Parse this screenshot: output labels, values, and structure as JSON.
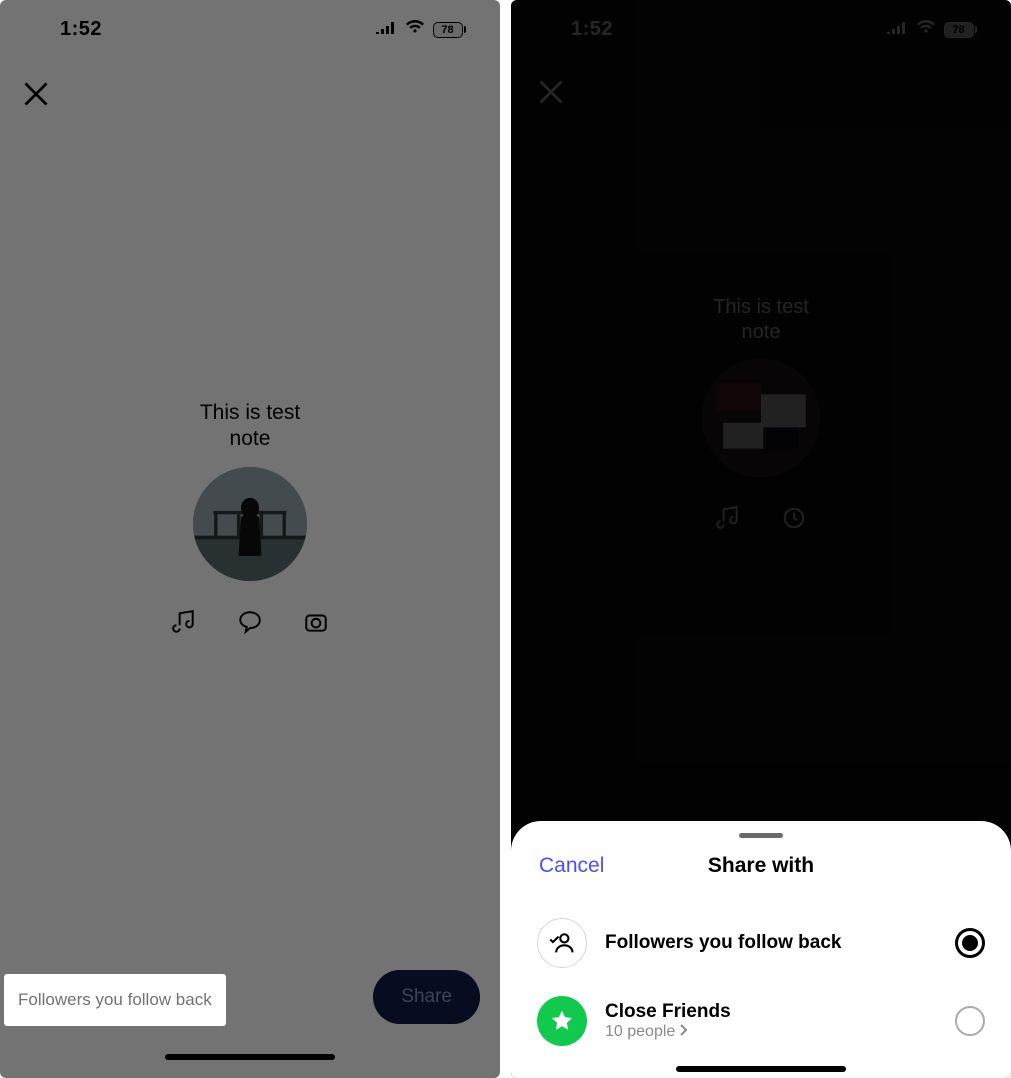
{
  "status": {
    "time": "1:52",
    "battery_pct": "78"
  },
  "left": {
    "note_text": "This is test\nnote",
    "chip_label": "Followers you follow back",
    "share_label": "Share"
  },
  "right": {
    "note_text": "This is test\nnote"
  },
  "sheet": {
    "cancel_label": "Cancel",
    "title": "Share with",
    "options": [
      {
        "label": "Followers you follow back",
        "sub": "",
        "selected": true,
        "icon": "followers"
      },
      {
        "label": "Close Friends",
        "sub": "10 people",
        "selected": false,
        "icon": "star"
      }
    ]
  }
}
